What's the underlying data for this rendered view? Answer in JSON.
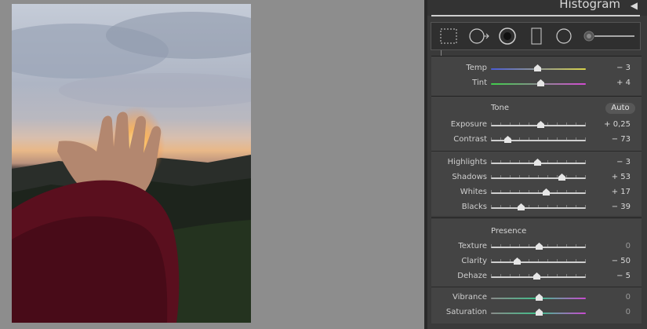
{
  "histogram": {
    "title": "Histogram"
  },
  "tools": [
    "crop-overlay-icon",
    "spot-removal-icon",
    "red-eye-icon",
    "graduated-filter-icon",
    "radial-filter-icon",
    "brush-icon"
  ],
  "white_balance": {
    "rows": [
      {
        "label": "Temp",
        "value": "− 3",
        "level": 0.49
      },
      {
        "label": "Tint",
        "value": "+ 4",
        "level": 0.52
      }
    ]
  },
  "tone": {
    "title": "Tone",
    "auto_label": "Auto",
    "rows_a": [
      {
        "label": "Exposure",
        "value": "+ 0,25",
        "level": 0.52
      },
      {
        "label": "Contrast",
        "value": "− 73",
        "level": 0.17
      }
    ],
    "rows_b": [
      {
        "label": "Highlights",
        "value": "− 3",
        "level": 0.49
      },
      {
        "label": "Shadows",
        "value": "+ 53",
        "level": 0.74
      },
      {
        "label": "Whites",
        "value": "+ 17",
        "level": 0.58
      },
      {
        "label": "Blacks",
        "value": "− 39",
        "level": 0.31
      }
    ]
  },
  "presence": {
    "title": "Presence",
    "rows_a": [
      {
        "label": "Texture",
        "value": "0",
        "level": 0.5
      },
      {
        "label": "Clarity",
        "value": "− 50",
        "level": 0.27
      },
      {
        "label": "Dehaze",
        "value": "− 5",
        "level": 0.48
      }
    ],
    "rows_b": [
      {
        "label": "Vibrance",
        "value": "0",
        "level": 0.5
      },
      {
        "label": "Saturation",
        "value": "0",
        "level": 0.5
      }
    ]
  }
}
